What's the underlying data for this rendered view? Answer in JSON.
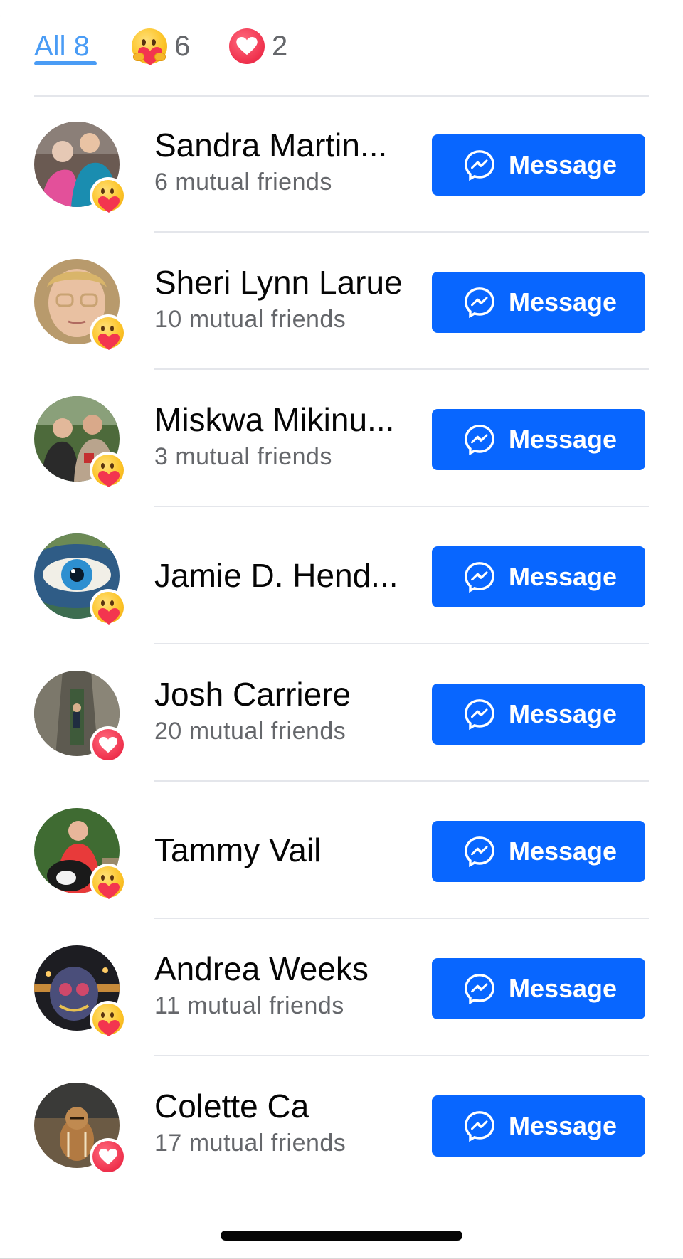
{
  "tabs": [
    {
      "label": "All 8",
      "type": "all"
    },
    {
      "count": "6",
      "reaction": "care-reaction-icon"
    },
    {
      "count": "2",
      "reaction": "love-reaction-icon"
    }
  ],
  "colors": {
    "accent_tab": "#4a9cf5",
    "button": "#0866ff",
    "secondary_text": "#65676b",
    "divider": "#e4e6eb"
  },
  "people": [
    {
      "name": "Sandra Martin...",
      "mutual": "6 mutual friends",
      "reaction": "care",
      "button": "Message"
    },
    {
      "name": "Sheri Lynn Larue",
      "mutual": "10 mutual friends",
      "reaction": "care",
      "button": "Message"
    },
    {
      "name": "Miskwa Mikinu...",
      "mutual": "3 mutual friends",
      "reaction": "care",
      "button": "Message"
    },
    {
      "name": "Jamie D. Hend...",
      "mutual": "",
      "reaction": "care",
      "button": "Message"
    },
    {
      "name": "Josh Carriere",
      "mutual": "20 mutual friends",
      "reaction": "love",
      "button": "Message"
    },
    {
      "name": "Tammy Vail",
      "mutual": "",
      "reaction": "care",
      "button": "Message"
    },
    {
      "name": "Andrea Weeks",
      "mutual": "11 mutual friends",
      "reaction": "care",
      "button": "Message"
    },
    {
      "name": "Colette Ca",
      "mutual": "17 mutual friends",
      "reaction": "love",
      "button": "Message"
    }
  ]
}
